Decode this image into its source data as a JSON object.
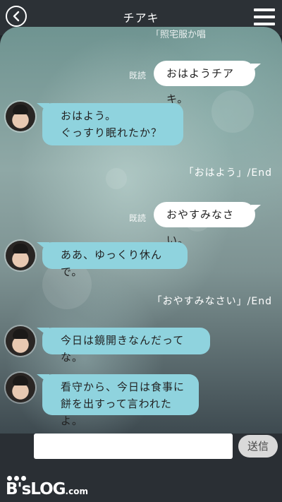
{
  "header": {
    "title": "チアキ",
    "back_icon": "chevron-left-icon",
    "menu_icon": "hamburger-menu-icon"
  },
  "chat": {
    "partial_top": "「照宅服か唱",
    "messages": [
      {
        "type": "outgoing",
        "read_label": "既読",
        "text": "おはようチアキ。"
      },
      {
        "type": "incoming",
        "lines": [
          "おはよう。",
          "ぐっすり眠れたか？"
        ]
      },
      {
        "type": "system",
        "text": "「おはよう」/End"
      },
      {
        "type": "outgoing",
        "read_label": "既読",
        "text": "おやすみなさい。"
      },
      {
        "type": "incoming",
        "lines": [
          "ああ、ゆっくり休んで。"
        ]
      },
      {
        "type": "system",
        "text": "「おやすみなさい」/End"
      },
      {
        "type": "incoming",
        "lines": [
          "今日は鏡開きなんだってな。"
        ]
      },
      {
        "type": "incoming",
        "lines": [
          "看守から、今日は食事に",
          "餅を出すって言われたよ。"
        ]
      }
    ]
  },
  "composer": {
    "value": "",
    "send_label": "送信"
  },
  "watermark": {
    "logo_text": "B'sLOG",
    "logo_suffix": ".com"
  },
  "colors": {
    "incoming_bubble": "#8fd3de",
    "outgoing_bubble": "#ffffff",
    "header_bg": "#2c3136"
  }
}
